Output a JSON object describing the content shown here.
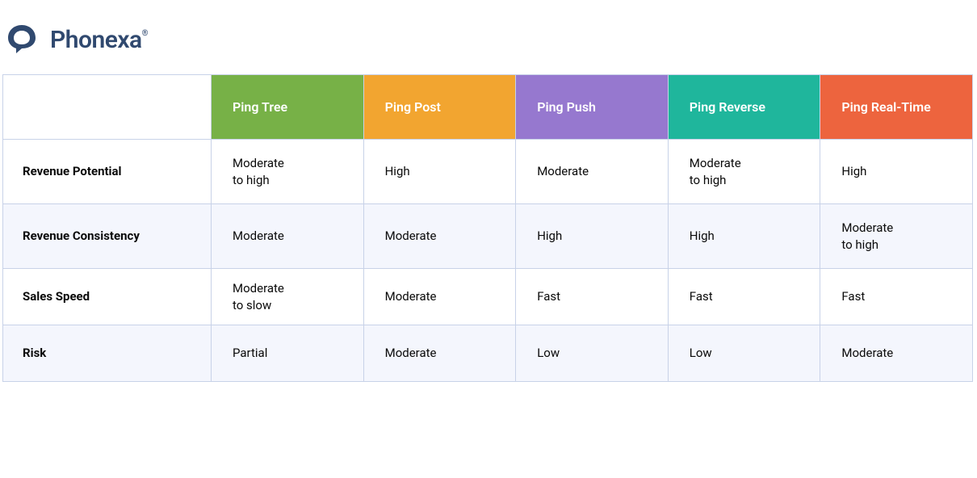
{
  "brand": {
    "name": "Phonexa",
    "registered_mark": "®",
    "logo_color": "#30496f"
  },
  "table": {
    "columns": [
      {
        "label": "Ping Tree",
        "color": "#77b147"
      },
      {
        "label": "Ping Post",
        "color": "#f2a530"
      },
      {
        "label": "Ping Push",
        "color": "#9678cf"
      },
      {
        "label": "Ping Reverse",
        "color": "#1fb69c"
      },
      {
        "label": "Ping Real-Time",
        "color": "#ed643e"
      }
    ],
    "rows": [
      {
        "label": "Revenue Potential",
        "cells": [
          "Moderate to high",
          "High",
          "Moderate",
          "Moderate to high",
          "High"
        ]
      },
      {
        "label": "Revenue Consistency",
        "cells": [
          "Moderate",
          "Moderate",
          "High",
          "High",
          "Moderate to high"
        ]
      },
      {
        "label": "Sales Speed",
        "cells": [
          "Moderate to slow",
          "Moderate",
          "Fast",
          "Fast",
          "Fast"
        ]
      },
      {
        "label": "Risk",
        "cells": [
          "Partial",
          "Moderate",
          "Low",
          "Low",
          "Moderate"
        ]
      }
    ]
  }
}
